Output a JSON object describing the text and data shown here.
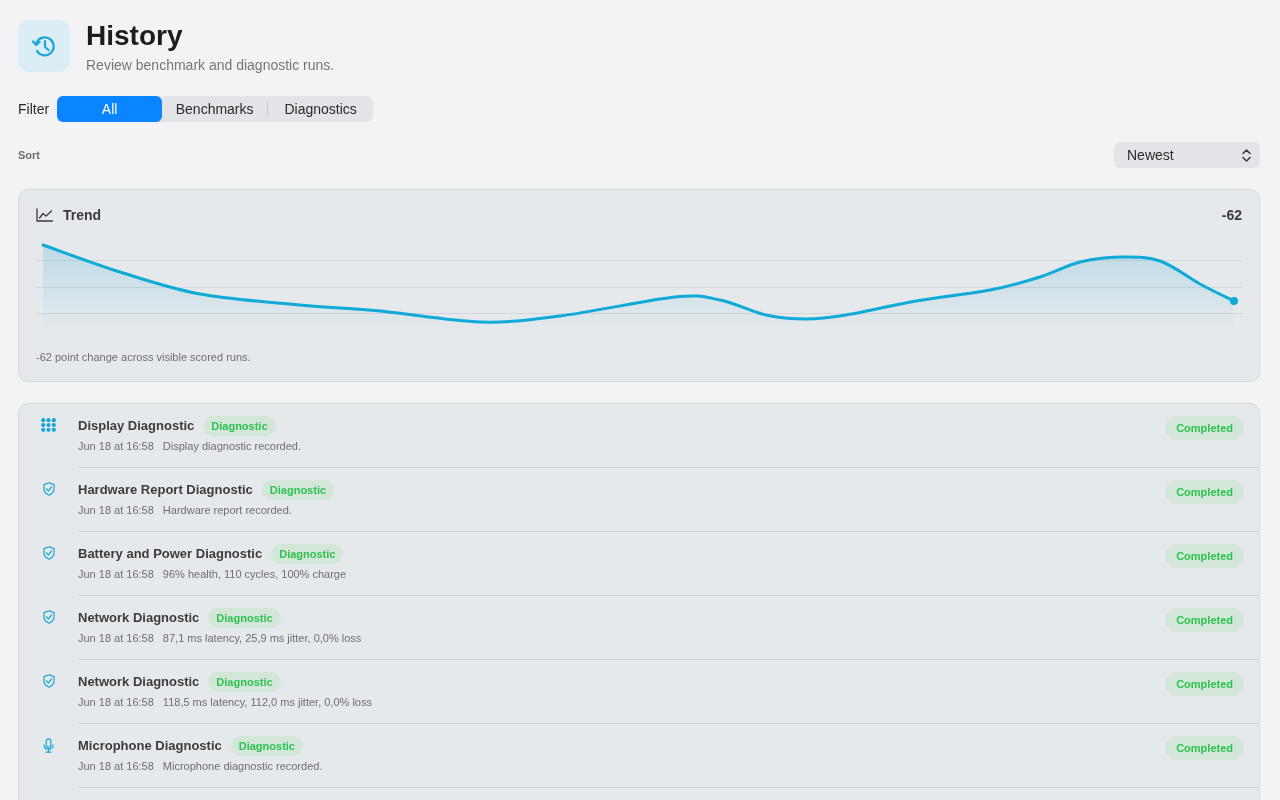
{
  "header": {
    "title": "History",
    "subtitle": "Review benchmark and diagnostic runs."
  },
  "filter": {
    "label": "Filter",
    "segments": [
      {
        "label": "All",
        "selected": true
      },
      {
        "label": "Benchmarks",
        "selected": false
      },
      {
        "label": "Diagnostics",
        "selected": false
      }
    ]
  },
  "sort": {
    "label": "Sort",
    "value": "Newest"
  },
  "trend": {
    "title": "Trend",
    "change": "-62",
    "caption": "-62 point change across visible scored runs."
  },
  "runs": [
    {
      "kind": "display",
      "title": "Display Diagnostic",
      "tag": "Diagnostic",
      "date": "Jun 18 at 16:58",
      "detail": "Display diagnostic recorded.",
      "status": "Completed"
    },
    {
      "kind": "hardware",
      "title": "Hardware Report Diagnostic",
      "tag": "Diagnostic",
      "date": "Jun 18 at 16:58",
      "detail": "Hardware report recorded.",
      "status": "Completed"
    },
    {
      "kind": "battery",
      "title": "Battery and Power Diagnostic",
      "tag": "Diagnostic",
      "date": "Jun 18 at 16:58",
      "detail": "96% health, 110 cycles, 100% charge",
      "status": "Completed"
    },
    {
      "kind": "network",
      "title": "Network Diagnostic",
      "tag": "Diagnostic",
      "date": "Jun 18 at 16:58",
      "detail": "87,1 ms latency, 25,9 ms jitter, 0,0% loss",
      "status": "Completed"
    },
    {
      "kind": "network",
      "title": "Network Diagnostic",
      "tag": "Diagnostic",
      "date": "Jun 18 at 16:58",
      "detail": "118,5 ms latency, 112,0 ms jitter, 0,0% loss",
      "status": "Completed"
    },
    {
      "kind": "microphone",
      "title": "Microphone Diagnostic",
      "tag": "Diagnostic",
      "date": "Jun 18 at 16:58",
      "detail": "Microphone diagnostic recorded.",
      "status": "Completed"
    }
  ]
}
